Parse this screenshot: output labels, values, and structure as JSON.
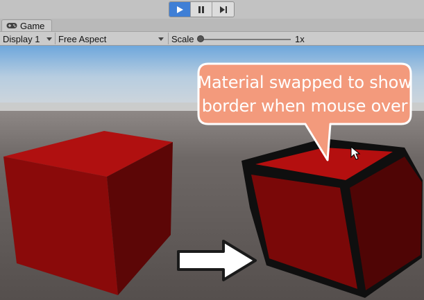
{
  "playbar": {
    "buttons": [
      {
        "name": "play",
        "icon": "play-icon",
        "active": true
      },
      {
        "name": "pause",
        "icon": "pause-icon",
        "active": false
      },
      {
        "name": "step",
        "icon": "step-icon",
        "active": false
      }
    ]
  },
  "tabs": [
    {
      "label": "Game",
      "icon": "gamepad-icon",
      "selected": true
    }
  ],
  "toolbar": {
    "display_label": "Display 1",
    "aspect_label": "Free Aspect",
    "scale_label": "Scale",
    "scale_value": "1x",
    "scale_slider_fraction": 0.0
  },
  "scene": {
    "callout_lines": [
      "Material swapped to show",
      "border when mouse over"
    ],
    "callout_color": "#f39a7c",
    "cube_color": "#b41010",
    "border_color": "#111111",
    "arrow_icon": "right-arrow-icon",
    "cursor_icon": "mouse-cursor-icon"
  }
}
